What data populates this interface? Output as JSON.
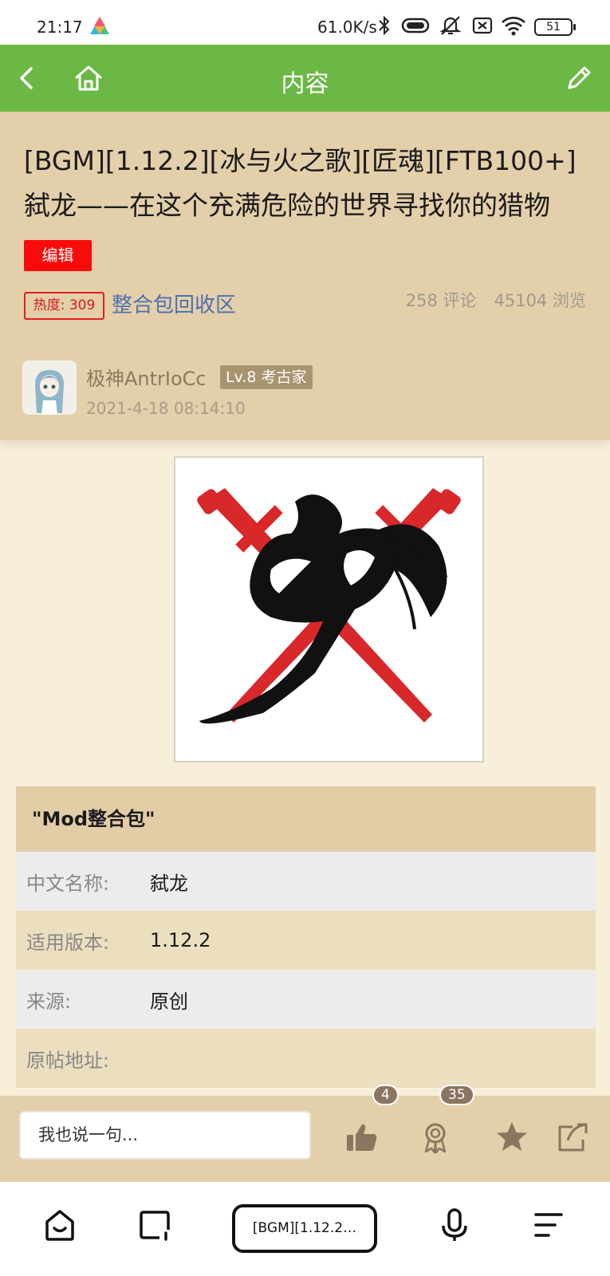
{
  "status_bar": {
    "time": "21:17",
    "net_speed": "61.0K/s",
    "battery": "51",
    "icons": [
      "app-logo-icon",
      "bluetooth-icon",
      "toggle-icon",
      "bell-off-icon",
      "sim-off-icon",
      "wifi-icon",
      "battery-icon"
    ]
  },
  "app_bar": {
    "title": "内容",
    "back_icon": "chevron-left-icon",
    "home_icon": "home-icon",
    "edit_icon": "pencil-icon",
    "color": "#6cb845"
  },
  "post": {
    "title": "[BGM][1.12.2][冰与火之歌][匠魂][FTB100+]弑龙——在这个充满危险的世界寻找你的猎物",
    "edit_label": "编辑",
    "heat_label": "热度: 309",
    "section": "整合包回收区",
    "comments": "258 评论",
    "views": "45104 浏览",
    "author": "极神AntrIoCc",
    "level": "Lv.8 考古家",
    "date": "2021-4-18 08:14:10"
  },
  "info_table": {
    "header": "\"Mod整合包\"",
    "rows": [
      {
        "key": "中文名称:",
        "value": "弑龙"
      },
      {
        "key": "适用版本:",
        "value": "1.12.2"
      },
      {
        "key": "来源:",
        "value": "原创"
      },
      {
        "key": "原帖地址:",
        "value": ""
      }
    ]
  },
  "action_bar": {
    "comment_placeholder": "我也说一句...",
    "likes": "4",
    "awards": "35",
    "icons": [
      "thumbs-up-icon",
      "award-icon",
      "star-icon",
      "share-icon"
    ]
  },
  "nav_bar": {
    "url": "[BGM][1.12.2…",
    "icons": [
      "home-icon",
      "tabs-icon",
      "mic-icon",
      "menu-icon"
    ]
  }
}
